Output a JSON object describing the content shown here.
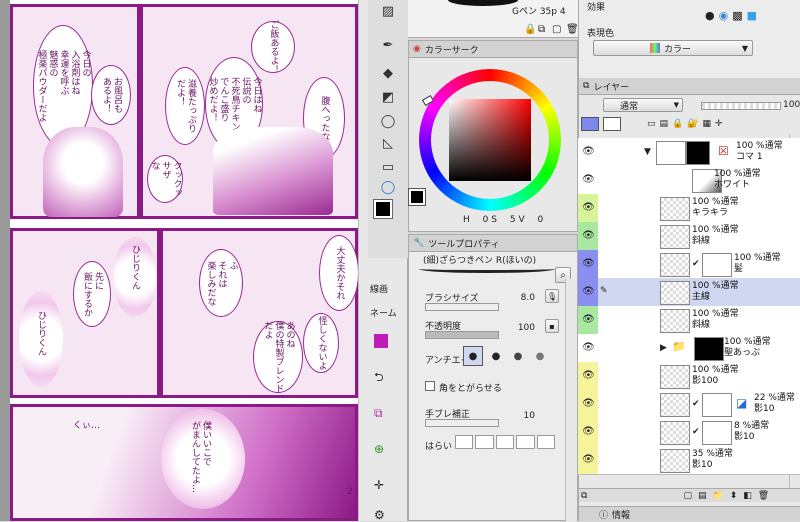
{
  "manga": {
    "bubbles": [
      {
        "text": "今日の\n入浴剤はね\n幸運を呼ぶ\n魅惑の\n極楽パウダーだよ"
      },
      {
        "text": "お風呂も\nあるよ！"
      },
      {
        "text": "ご飯あるよ！"
      },
      {
        "text": "今日はね\n伝説の\n不死鳥チキン\nでんこ盛り\n炒めだよ！"
      },
      {
        "text": "滋養たっぷり\nだよ！"
      },
      {
        "text": "腹へったな"
      },
      {
        "text": "クックッ\nサザ\nな"
      },
      {
        "text": "ひじりくん"
      },
      {
        "text": "先に\n飯にするか"
      },
      {
        "text": "ひじりくん"
      },
      {
        "text": "ふ\nそれは\n楽しみだな"
      },
      {
        "text": "あのね\n僕の特製ブレンド\nだよ"
      },
      {
        "text": "大丈夫かそれ"
      },
      {
        "text": "怪しくないよ"
      },
      {
        "text": "くぃ…"
      },
      {
        "text": "僕いいこで\nがまんしてたよ…"
      }
    ],
    "page_number": "2"
  },
  "toolbar_top": {
    "brush_label": "Gペン 35p 4"
  },
  "color_circle": {
    "tab_label": "カラーサーク",
    "h_label": "H",
    "h_value": "0",
    "s_label": "S",
    "s_value": "5",
    "v_label": "V",
    "v_value": "0"
  },
  "tool_property": {
    "tab_label": "ツールプロパティ",
    "tool_name": "(細)ざらつきペン R(ほいの)",
    "brush_size_label": "ブラシサイズ",
    "brush_size_value": "8.0",
    "opacity_label": "不透明度",
    "opacity_value": "100",
    "antialias_label": "アンチエイリ",
    "sharp_corner_label": "角をとがらせる",
    "stabilization_label": "手ブレ補正",
    "stabilization_value": "10",
    "taper_label": "はらい"
  },
  "subtool": {
    "tab1": "線画",
    "tab2": "ネーム"
  },
  "effect_panel": {
    "effect_label": "効果",
    "expression_color_label": "表現色",
    "expression_color_value": "カラー"
  },
  "layer_panel": {
    "tab_label": "レイヤー",
    "blend_mode": "通常",
    "opacity_readout": "100",
    "layers": [
      {
        "name": "100 %通常\nコマ 1",
        "color": "#ffffff"
      },
      {
        "name": "100 %通常\nホワイト",
        "color": "#ffffff"
      },
      {
        "name": "100 %通常\nキラキラ",
        "color": "#d8f49a"
      },
      {
        "name": "100 %通常\n斜線",
        "color": "#a8e8a0"
      },
      {
        "name": "100 %通常\n髪",
        "color": "#8a8ef0"
      },
      {
        "name": "100 %通常\n主線",
        "color": "#8a8ef0"
      },
      {
        "name": "100 %通常\n斜線",
        "color": "#a8e8a0"
      },
      {
        "name": "100 %通常\n聖あっぷ",
        "color": "#ffffff"
      },
      {
        "name": "100 %通常\n影100",
        "color": "#f6f49a"
      },
      {
        "name": "22 %通常\n影10",
        "color": "#f6f49a"
      },
      {
        "name": "8 %通常\n影10",
        "color": "#f6f49a"
      },
      {
        "name": "35 %通常\n影10",
        "color": "#f6f49a"
      }
    ]
  },
  "info_panel": {
    "tab_label": "情報"
  },
  "colors": {
    "accent": "#8c1a86",
    "panel_bg": "#e4e4e4",
    "selected_layer": "#cfd8f0"
  }
}
